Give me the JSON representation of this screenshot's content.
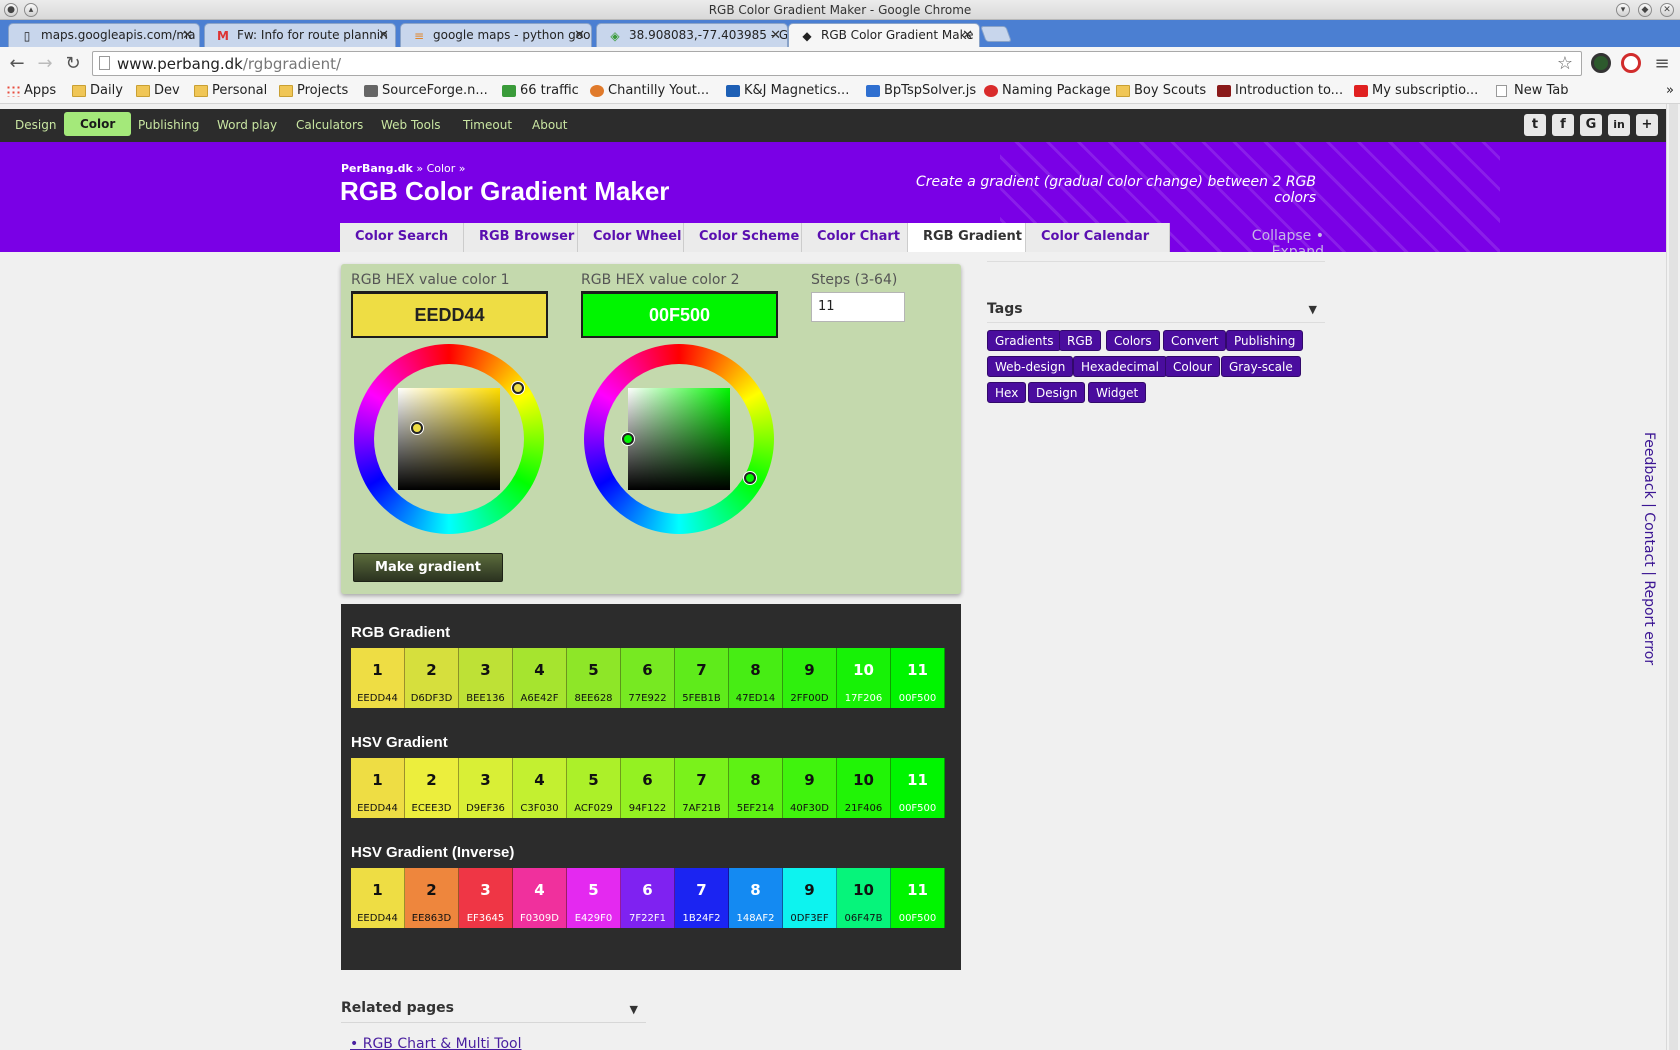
{
  "window": {
    "title": "RGB Color Gradient Maker - Google Chrome"
  },
  "tabs": [
    {
      "label": "maps.googleapis.com/ma",
      "icon": "page-icon"
    },
    {
      "label": "Fw: Info for route plannin",
      "icon": "gmail-icon"
    },
    {
      "label": "google maps - python goo",
      "icon": "stackoverflow-icon"
    },
    {
      "label": "38.908083,-77.403985 - G",
      "icon": "maps-icon"
    },
    {
      "label": "RGB Color Gradient Make",
      "icon": "perbang-icon"
    }
  ],
  "address": {
    "host": "www.perbang.dk",
    "path": "/rgbgradient/"
  },
  "bookmarks": [
    {
      "label": "Apps",
      "icon": "apps"
    },
    {
      "label": "Daily",
      "icon": "folder"
    },
    {
      "label": "Dev",
      "icon": "folder"
    },
    {
      "label": "Personal",
      "icon": "folder"
    },
    {
      "label": "Projects",
      "icon": "folder"
    },
    {
      "label": "SourceForge.n...",
      "icon": "gen"
    },
    {
      "label": "66 traffic",
      "icon": "gen"
    },
    {
      "label": "Chantilly Yout...",
      "icon": "gen"
    },
    {
      "label": "K&J Magnetics...",
      "icon": "gen"
    },
    {
      "label": "BpTspSolver.js",
      "icon": "gen"
    },
    {
      "label": "Naming Package",
      "icon": "gen"
    },
    {
      "label": "Boy Scouts",
      "icon": "folder"
    },
    {
      "label": "Introduction to...",
      "icon": "gen"
    },
    {
      "label": "My subscriptio...",
      "icon": "gen"
    },
    {
      "label": "New Tab",
      "icon": "page"
    }
  ],
  "sitenav": [
    "Design",
    "Color",
    "Publishing",
    "Word play",
    "Calculators",
    "Web Tools",
    "Timeout",
    "About"
  ],
  "social": [
    "t",
    "f",
    "G",
    "in",
    "+"
  ],
  "header": {
    "crumb_home": "PerBang.dk",
    "crumb_sep": "»",
    "crumb_color": "Color",
    "title": "RGB Color Gradient Maker",
    "tagline": "Create a gradient (gradual color change) between 2 RGB colors",
    "collapse": "Collapse • Expand"
  },
  "subtabs": [
    "Color Search",
    "RGB Browser",
    "Color Wheel",
    "Color Scheme",
    "Color Chart",
    "RGB Gradient",
    "Color Calendar"
  ],
  "form": {
    "label1": "RGB HEX value color 1",
    "label2": "RGB HEX value color 2",
    "label_steps": "Steps (3-64)",
    "color1": "EEDD44",
    "color2": "00F500",
    "steps": "11",
    "make_button": "Make gradient"
  },
  "gradients": [
    {
      "title": "RGB Gradient",
      "cells": [
        "EEDD44",
        "D6DF3D",
        "BEE136",
        "A6E42F",
        "8EE628",
        "77E922",
        "5FEB1B",
        "47ED14",
        "2FF00D",
        "17F206",
        "00F500"
      ]
    },
    {
      "title": "HSV Gradient",
      "cells": [
        "EEDD44",
        "ECEE3D",
        "D9EF36",
        "C3F030",
        "ACF029",
        "94F122",
        "7AF21B",
        "5EF214",
        "40F30D",
        "21F406",
        "00F500"
      ]
    },
    {
      "title": "HSV Gradient (Inverse)",
      "cells": [
        "EEDD44",
        "EE863D",
        "EF3645",
        "F0309D",
        "E429F0",
        "7F22F1",
        "1B24F2",
        "148AF2",
        "0DF3EF",
        "06F47B",
        "00F500"
      ]
    }
  ],
  "tags_title": "Tags",
  "tags": [
    "Gradients",
    "RGB",
    "Colors",
    "Convert",
    "Publishing",
    "Web-design",
    "Hexadecimal",
    "Colour",
    "Gray-scale",
    "Hex",
    "Design",
    "Widget"
  ],
  "related": {
    "title": "Related pages",
    "link": "RGB Chart & Multi Tool"
  },
  "feedback": "Feedback | Contact | Report error"
}
